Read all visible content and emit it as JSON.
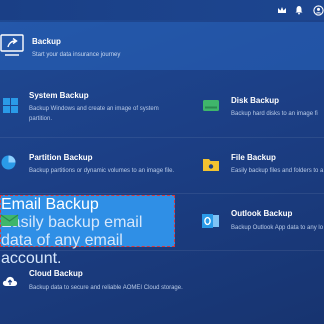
{
  "header": {
    "title": "Backup",
    "subtitle": "Start your data insurance journey"
  },
  "tiles": {
    "system": {
      "title": "System Backup",
      "desc1": "Backup Windows and create an image of system",
      "desc2": "partition."
    },
    "disk": {
      "title": "Disk Backup",
      "desc1": "Backup hard disks to an image fi"
    },
    "partition": {
      "title": "Partition Backup",
      "desc1": "Backup partitions or dynamic volumes to an image file."
    },
    "file": {
      "title": "File Backup",
      "desc1": "Easily backup files and folders to a"
    },
    "email": {
      "title": "Email Backup",
      "desc1": "Easily backup email data of any email account."
    },
    "outlook": {
      "title": "Outlook Backup",
      "desc1": "Backup Outlook App data to any lo"
    },
    "cloud": {
      "title": "Cloud Backup",
      "desc1": "Backup data to secure and reliable AOMEI Cloud storage."
    }
  },
  "colors": {
    "accent": "#2f8fe6",
    "selection_border": "#d8383a",
    "icon_green": "#3fb66b",
    "icon_yellow": "#f2c230",
    "icon_blue": "#2a9ae8"
  },
  "icons": [
    "crown-icon",
    "bell-icon",
    "user-icon",
    "backup-header-icon",
    "windows-icon",
    "disk-icon",
    "pie-chart-icon",
    "folder-icon",
    "email-icon",
    "outlook-icon",
    "cloud-upload-icon"
  ]
}
